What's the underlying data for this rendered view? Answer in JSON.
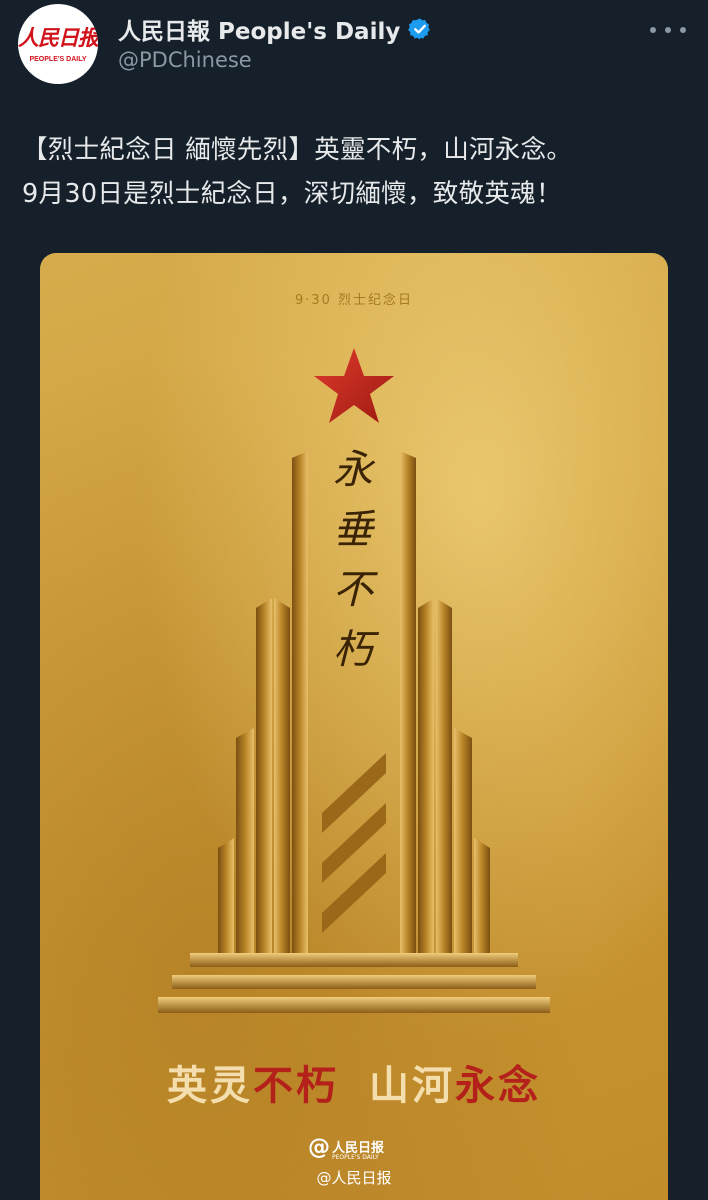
{
  "account": {
    "display_name": "人民日報 People's Daily",
    "handle": "@PDChinese",
    "avatar_logo_cn": "人民日报",
    "avatar_logo_en": "PEOPLE'S DAILY"
  },
  "tweet": {
    "line1": "【烈士紀念日 緬懷先烈】英靈不朽，山河永念。",
    "line2": "9月30日是烈士紀念日，深切緬懷，致敬英魂！"
  },
  "poster": {
    "date_label": "9·30 烈士纪念日",
    "calligraphy": "永垂不朽",
    "slogan_part1_white": "英灵",
    "slogan_part1_red": "不朽",
    "slogan_part2_white": "山河",
    "slogan_part2_red": "永念",
    "logo_at": "@",
    "logo_cn": "人民日报",
    "logo_en": "PEOPLE'S DAILY",
    "watermark": "@人民日报"
  },
  "colors": {
    "background": "#15202b",
    "verified": "#1d9bf0",
    "gold": "#c99632",
    "star_red": "#c8251b",
    "slogan_red": "#b3211a"
  },
  "icons": [
    "verified-badge-icon",
    "more-options-icon"
  ]
}
